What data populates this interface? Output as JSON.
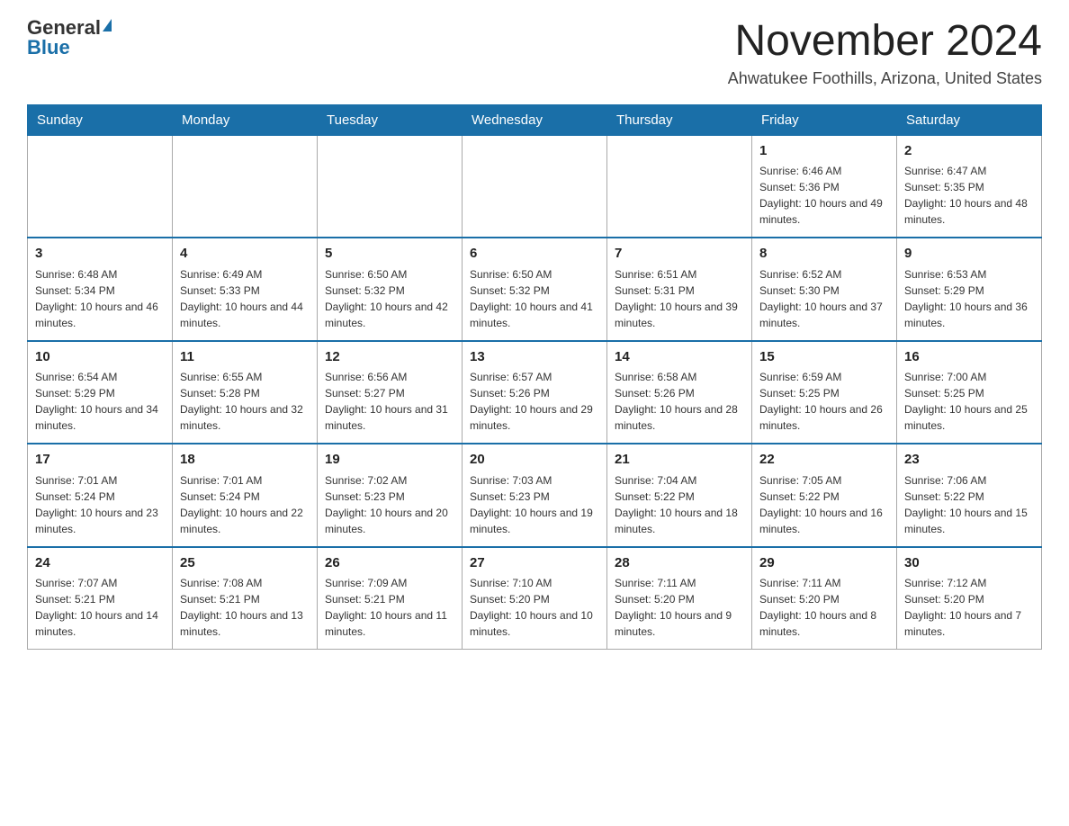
{
  "logo": {
    "general": "General",
    "blue": "Blue"
  },
  "header": {
    "month": "November 2024",
    "location": "Ahwatukee Foothills, Arizona, United States"
  },
  "weekdays": [
    "Sunday",
    "Monday",
    "Tuesday",
    "Wednesday",
    "Thursday",
    "Friday",
    "Saturday"
  ],
  "weeks": [
    [
      {
        "day": "",
        "info": ""
      },
      {
        "day": "",
        "info": ""
      },
      {
        "day": "",
        "info": ""
      },
      {
        "day": "",
        "info": ""
      },
      {
        "day": "",
        "info": ""
      },
      {
        "day": "1",
        "info": "Sunrise: 6:46 AM\nSunset: 5:36 PM\nDaylight: 10 hours and 49 minutes."
      },
      {
        "day": "2",
        "info": "Sunrise: 6:47 AM\nSunset: 5:35 PM\nDaylight: 10 hours and 48 minutes."
      }
    ],
    [
      {
        "day": "3",
        "info": "Sunrise: 6:48 AM\nSunset: 5:34 PM\nDaylight: 10 hours and 46 minutes."
      },
      {
        "day": "4",
        "info": "Sunrise: 6:49 AM\nSunset: 5:33 PM\nDaylight: 10 hours and 44 minutes."
      },
      {
        "day": "5",
        "info": "Sunrise: 6:50 AM\nSunset: 5:32 PM\nDaylight: 10 hours and 42 minutes."
      },
      {
        "day": "6",
        "info": "Sunrise: 6:50 AM\nSunset: 5:32 PM\nDaylight: 10 hours and 41 minutes."
      },
      {
        "day": "7",
        "info": "Sunrise: 6:51 AM\nSunset: 5:31 PM\nDaylight: 10 hours and 39 minutes."
      },
      {
        "day": "8",
        "info": "Sunrise: 6:52 AM\nSunset: 5:30 PM\nDaylight: 10 hours and 37 minutes."
      },
      {
        "day": "9",
        "info": "Sunrise: 6:53 AM\nSunset: 5:29 PM\nDaylight: 10 hours and 36 minutes."
      }
    ],
    [
      {
        "day": "10",
        "info": "Sunrise: 6:54 AM\nSunset: 5:29 PM\nDaylight: 10 hours and 34 minutes."
      },
      {
        "day": "11",
        "info": "Sunrise: 6:55 AM\nSunset: 5:28 PM\nDaylight: 10 hours and 32 minutes."
      },
      {
        "day": "12",
        "info": "Sunrise: 6:56 AM\nSunset: 5:27 PM\nDaylight: 10 hours and 31 minutes."
      },
      {
        "day": "13",
        "info": "Sunrise: 6:57 AM\nSunset: 5:26 PM\nDaylight: 10 hours and 29 minutes."
      },
      {
        "day": "14",
        "info": "Sunrise: 6:58 AM\nSunset: 5:26 PM\nDaylight: 10 hours and 28 minutes."
      },
      {
        "day": "15",
        "info": "Sunrise: 6:59 AM\nSunset: 5:25 PM\nDaylight: 10 hours and 26 minutes."
      },
      {
        "day": "16",
        "info": "Sunrise: 7:00 AM\nSunset: 5:25 PM\nDaylight: 10 hours and 25 minutes."
      }
    ],
    [
      {
        "day": "17",
        "info": "Sunrise: 7:01 AM\nSunset: 5:24 PM\nDaylight: 10 hours and 23 minutes."
      },
      {
        "day": "18",
        "info": "Sunrise: 7:01 AM\nSunset: 5:24 PM\nDaylight: 10 hours and 22 minutes."
      },
      {
        "day": "19",
        "info": "Sunrise: 7:02 AM\nSunset: 5:23 PM\nDaylight: 10 hours and 20 minutes."
      },
      {
        "day": "20",
        "info": "Sunrise: 7:03 AM\nSunset: 5:23 PM\nDaylight: 10 hours and 19 minutes."
      },
      {
        "day": "21",
        "info": "Sunrise: 7:04 AM\nSunset: 5:22 PM\nDaylight: 10 hours and 18 minutes."
      },
      {
        "day": "22",
        "info": "Sunrise: 7:05 AM\nSunset: 5:22 PM\nDaylight: 10 hours and 16 minutes."
      },
      {
        "day": "23",
        "info": "Sunrise: 7:06 AM\nSunset: 5:22 PM\nDaylight: 10 hours and 15 minutes."
      }
    ],
    [
      {
        "day": "24",
        "info": "Sunrise: 7:07 AM\nSunset: 5:21 PM\nDaylight: 10 hours and 14 minutes."
      },
      {
        "day": "25",
        "info": "Sunrise: 7:08 AM\nSunset: 5:21 PM\nDaylight: 10 hours and 13 minutes."
      },
      {
        "day": "26",
        "info": "Sunrise: 7:09 AM\nSunset: 5:21 PM\nDaylight: 10 hours and 11 minutes."
      },
      {
        "day": "27",
        "info": "Sunrise: 7:10 AM\nSunset: 5:20 PM\nDaylight: 10 hours and 10 minutes."
      },
      {
        "day": "28",
        "info": "Sunrise: 7:11 AM\nSunset: 5:20 PM\nDaylight: 10 hours and 9 minutes."
      },
      {
        "day": "29",
        "info": "Sunrise: 7:11 AM\nSunset: 5:20 PM\nDaylight: 10 hours and 8 minutes."
      },
      {
        "day": "30",
        "info": "Sunrise: 7:12 AM\nSunset: 5:20 PM\nDaylight: 10 hours and 7 minutes."
      }
    ]
  ]
}
